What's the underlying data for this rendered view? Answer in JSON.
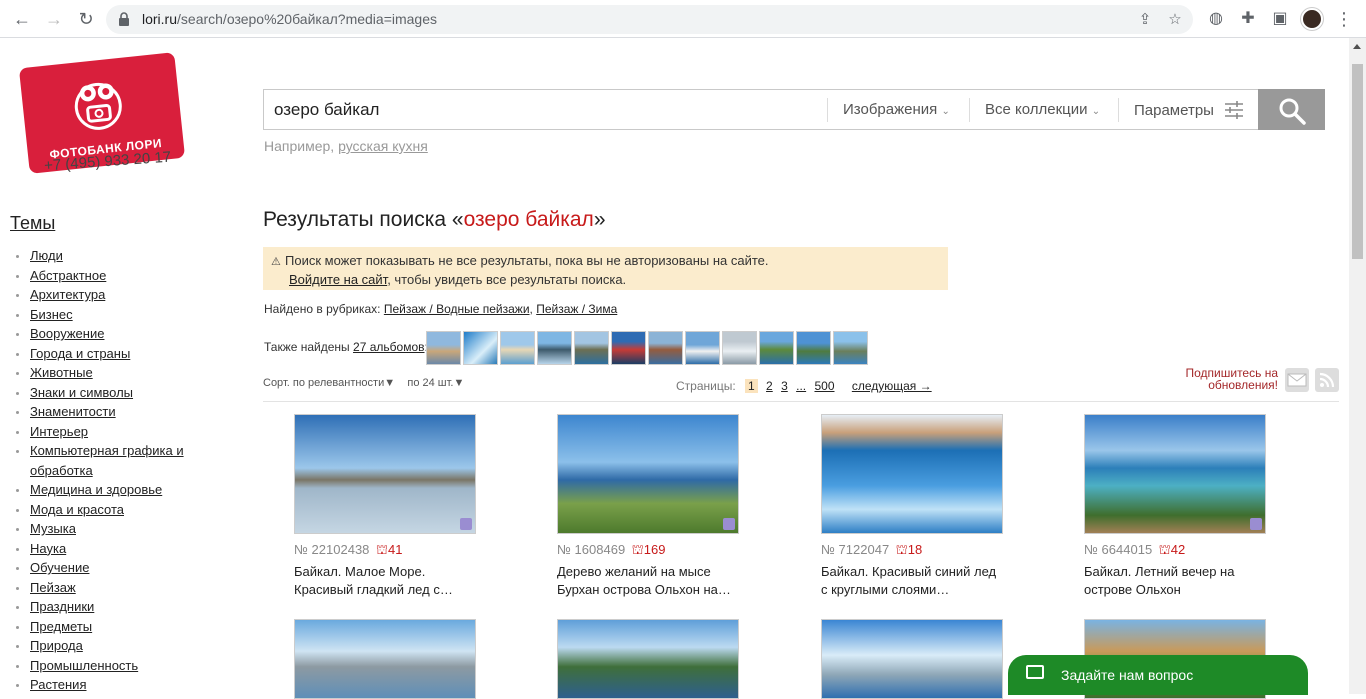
{
  "browser": {
    "url_host": "lori.ru",
    "url_path": "/search/озеро%20байкал?media=images"
  },
  "logo": {
    "brand": "ФОТОБАНК ЛОРИ",
    "phone": "+7 (495) 933 20 17"
  },
  "search": {
    "value": "озеро байкал",
    "media_filter": "Изображения",
    "collection_filter": "Все коллекции",
    "params_label": "Параметры",
    "example_prefix": "Например,",
    "example_link": "русская кухня"
  },
  "sidebar": {
    "title": "Темы",
    "items": [
      "Люди",
      "Абстрактное",
      "Архитектура",
      "Бизнес",
      "Вооружение",
      "Города и страны",
      "Животные",
      "Знаки и символы",
      "Знаменитости",
      "Интерьер",
      "Компьютерная графика и",
      "обработка",
      "Медицина и здоровье",
      "Мода и красота",
      "Музыка",
      "Наука",
      "Обучение",
      "Пейзаж",
      "Праздники",
      "Предметы",
      "Природа",
      "Промышленность",
      "Растения"
    ]
  },
  "results": {
    "title_prefix": "Результаты поиска «",
    "query": "озеро байкал",
    "title_suffix": "»",
    "notice_line1": "Поиск может показывать не все результаты, пока вы не авторизованы на сайте.",
    "notice_link": "Войдите на сайт",
    "notice_line2_rest": ", чтобы увидеть все результаты поиска.",
    "rubrics_label": "Найдено в рубриках:",
    "rubric1": "Пейзаж / Водные пейзажи",
    "rubric_sep": ", ",
    "rubric2": "Пейзаж / Зима",
    "albums_label": "Также найдены",
    "albums_link": "27 альбомов",
    "albums_colon": ":",
    "sort_label": "Сорт. по релевантности",
    "per_page": "по 24 шт.",
    "pages_label": "Страницы:",
    "pages": [
      "1",
      "2",
      "3",
      "...",
      "500"
    ],
    "next_label": "следующая →",
    "subscribe": "Подпишитесь на обновления!"
  },
  "photos": [
    {
      "id": "№ 22102438",
      "likes": "41",
      "caption": "Байкал. Малое Море. Красивый гладкий лед с…"
    },
    {
      "id": "№ 1608469",
      "likes": "169",
      "caption": "Дерево желаний на мысе Бурхан острова Ольхон на…"
    },
    {
      "id": "№ 7122047",
      "likes": "18",
      "caption": "Байкал. Красивый синий лед с круглыми слоями…"
    },
    {
      "id": "№ 6644015",
      "likes": "42",
      "caption": "Байкал. Летний вечер на острове Ольхон"
    }
  ],
  "chat": {
    "label": "Задайте нам вопрос"
  },
  "colors": {
    "brand_red": "#d91f3c",
    "query_red": "#c71a1a",
    "notice_bg": "#fbeccd",
    "chat_green": "#1e8a27"
  }
}
